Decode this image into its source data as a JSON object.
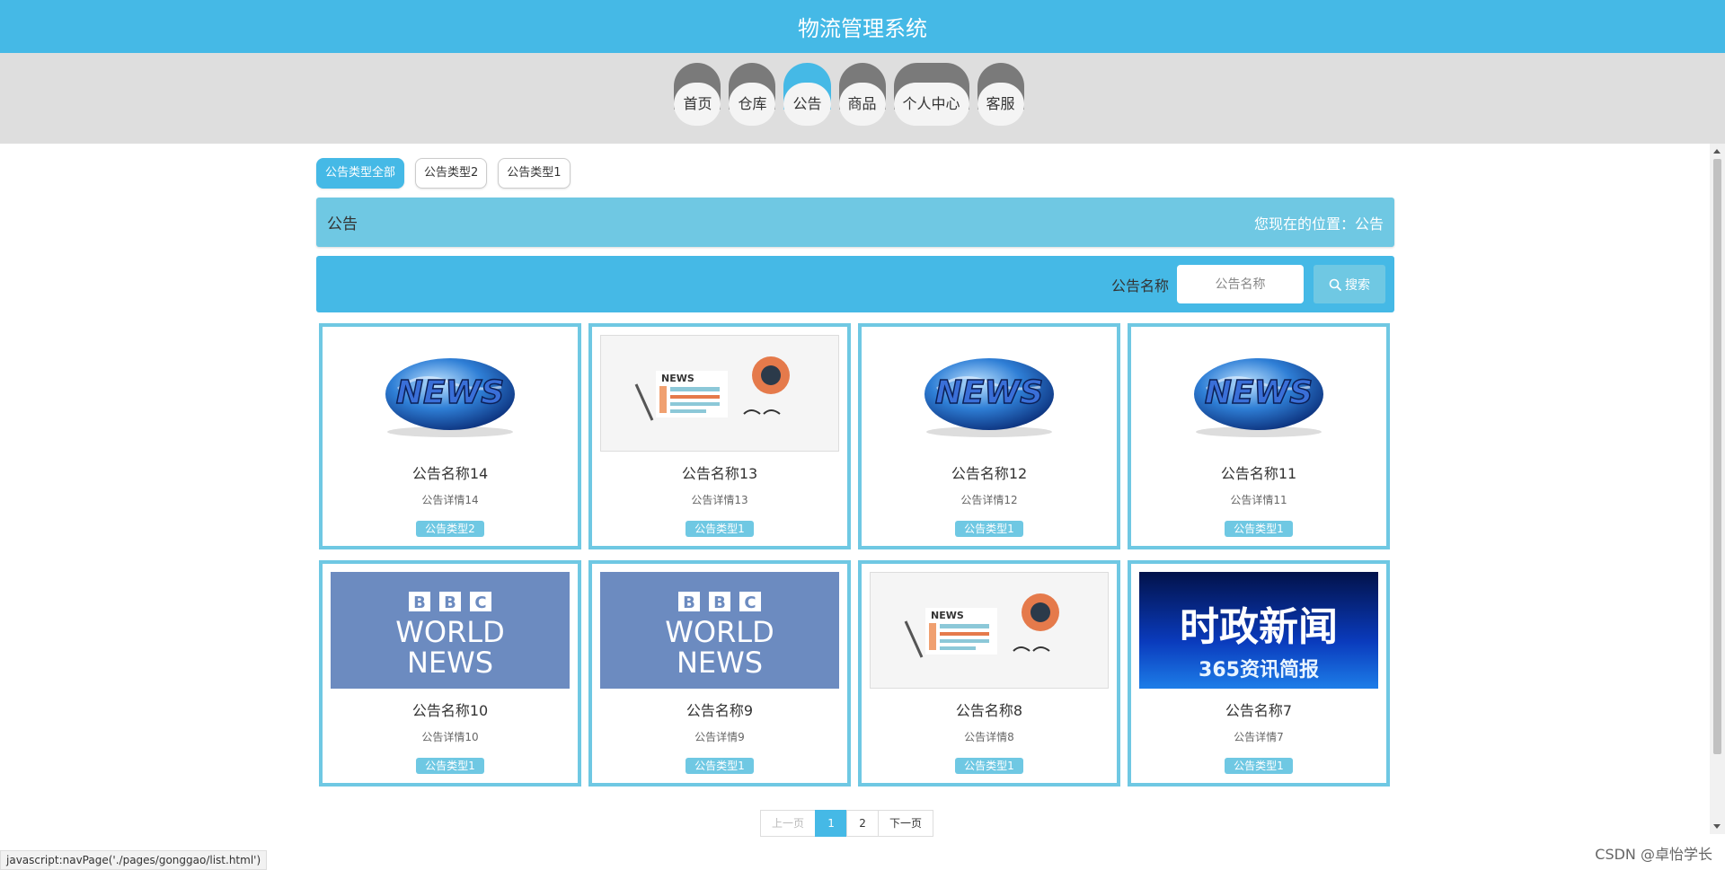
{
  "app": {
    "title": "物流管理系统"
  },
  "nav": {
    "items": [
      {
        "label": "首页"
      },
      {
        "label": "仓库"
      },
      {
        "label": "公告"
      },
      {
        "label": "商品"
      },
      {
        "label": "个人中心"
      },
      {
        "label": "客服"
      }
    ],
    "active_index": 2
  },
  "filters": {
    "tabs": [
      {
        "label": "公告类型全部",
        "active": true
      },
      {
        "label": "公告类型2",
        "active": false
      },
      {
        "label": "公告类型1",
        "active": false
      }
    ]
  },
  "breadcrumb": {
    "section": "公告",
    "location": "您现在的位置：公告"
  },
  "search": {
    "label": "公告名称",
    "placeholder": "公告名称",
    "value": "",
    "button_label": "搜索"
  },
  "cards": [
    {
      "name": "公告名称14",
      "detail": "公告详情14",
      "type": "公告类型2",
      "image": "news-globe"
    },
    {
      "name": "公告名称13",
      "detail": "公告详情13",
      "type": "公告类型1",
      "image": "news-paper"
    },
    {
      "name": "公告名称12",
      "detail": "公告详情12",
      "type": "公告类型1",
      "image": "news-globe"
    },
    {
      "name": "公告名称11",
      "detail": "公告详情11",
      "type": "公告类型1",
      "image": "news-globe"
    },
    {
      "name": "公告名称10",
      "detail": "公告详情10",
      "type": "公告类型1",
      "image": "bbc-world-news"
    },
    {
      "name": "公告名称9",
      "detail": "公告详情9",
      "type": "公告类型1",
      "image": "bbc-world-news"
    },
    {
      "name": "公告名称8",
      "detail": "公告详情8",
      "type": "公告类型1",
      "image": "news-paper"
    },
    {
      "name": "公告名称7",
      "detail": "公告详情7",
      "type": "公告类型1",
      "image": "political-news"
    }
  ],
  "image_text": {
    "news": "NEWS",
    "bbc_1": "BBC",
    "bbc_2": "WORLD",
    "bbc_3": "NEWS",
    "political_1": "时政新闻",
    "political_2": "365资讯简报"
  },
  "pagination": {
    "prev": "上一页",
    "pages": [
      "1",
      "2"
    ],
    "current": "1",
    "next": "下一页"
  },
  "statusbar": {
    "text": "javascript:navPage('./pages/gonggao/list.html')"
  },
  "watermark": {
    "text": "CSDN @卓怡学长"
  },
  "colors": {
    "primary": "#45b9e6",
    "secondary": "#6fc8e3",
    "nav_bump": "#7a7a7a",
    "nav_band": "#dedede"
  }
}
